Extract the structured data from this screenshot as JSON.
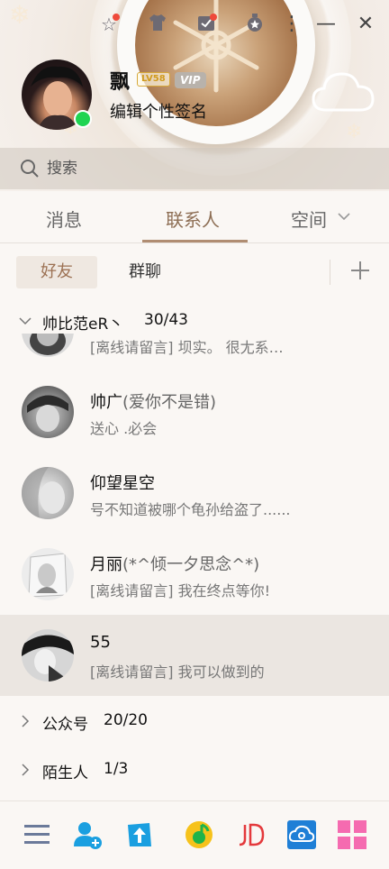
{
  "profile": {
    "nickname": "飘",
    "level_badge": "LV58",
    "vip_badge": "VIP",
    "signature": "编辑个性签名"
  },
  "search": {
    "placeholder": "搜索"
  },
  "main_tabs": [
    {
      "label": "消息"
    },
    {
      "label": "联系人"
    },
    {
      "label": "空间"
    }
  ],
  "sub_tabs": [
    {
      "label": "好友"
    },
    {
      "label": "群聊"
    }
  ],
  "groups": {
    "friends": {
      "name": "帅比范eR丶",
      "count": "30/43"
    },
    "official": {
      "name": "公众号",
      "count": "20/20"
    },
    "strangers": {
      "name": "陌生人",
      "count": "1/3"
    }
  },
  "contacts": [
    {
      "name": "",
      "remark": "",
      "message": "[离线请留言]  坝实。 很尢系…"
    },
    {
      "name": "帅广",
      "remark": "(爱你不是错)",
      "message": "送心 .必会"
    },
    {
      "name": "仰望星空",
      "remark": "",
      "message": "号不知道被哪个龟孙给盗了......"
    },
    {
      "name": "月丽",
      "remark": "(*^倾一夕思念^*)",
      "message": "[离线请留言]  我在终点等你!"
    },
    {
      "name": "55",
      "remark": "",
      "message": "[离线请留言]  我可以做到的"
    }
  ],
  "colors": {
    "accent": "#8d6e54",
    "online": "#1fd451",
    "notification_dot": "#ef4a3b"
  }
}
